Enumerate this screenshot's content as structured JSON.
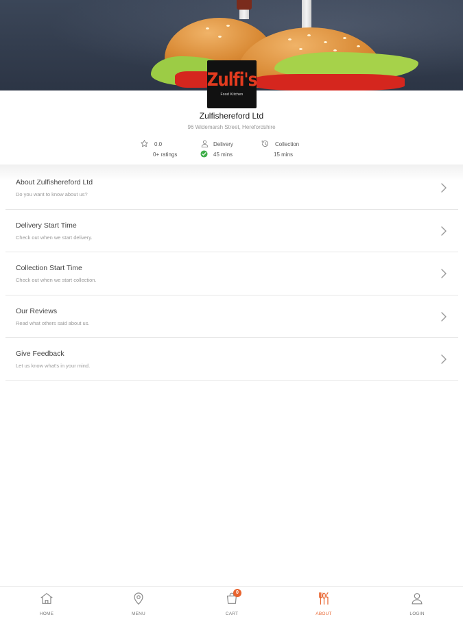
{
  "restaurant": {
    "logo_text": "Zulfi's",
    "logo_subtext": "Food Kitchen",
    "name": "Zulfishereford Ltd",
    "address": "96 Widemarsh Street, Herefordshire"
  },
  "stats": {
    "rating": {
      "icon": "star-icon",
      "value": "0.0",
      "label": "0+ ratings"
    },
    "delivery": {
      "icon": "delivery-person-icon",
      "label": "Delivery",
      "status_icon": "check-circle-icon",
      "time": "45 mins"
    },
    "collection": {
      "icon": "clock-history-icon",
      "label": "Collection",
      "time": "15 mins"
    }
  },
  "about_items": [
    {
      "title": "About Zulfishereford Ltd",
      "description": "Do you want to know about us?"
    },
    {
      "title": "Delivery Start Time",
      "description": "Check out when we start delivery."
    },
    {
      "title": "Collection Start Time",
      "description": "Check out when we start collection."
    },
    {
      "title": "Our Reviews",
      "description": "Read what others said about us."
    },
    {
      "title": "Give Feedback",
      "description": "Let us know what's in your mind."
    }
  ],
  "bottom_nav": {
    "home": {
      "label": "HOME",
      "icon": "home-icon"
    },
    "menu": {
      "label": "MENU",
      "icon": "location-pin-icon"
    },
    "cart": {
      "label": "CART",
      "icon": "shopping-bag-icon",
      "badge": "0"
    },
    "about": {
      "label": "ABOUT",
      "icon": "fork-knife-icon"
    },
    "login": {
      "label": "LOGIN",
      "icon": "user-icon"
    }
  },
  "colors": {
    "accent": "#e8642f",
    "success": "#3fae49",
    "logo_red": "#e23b1f"
  }
}
